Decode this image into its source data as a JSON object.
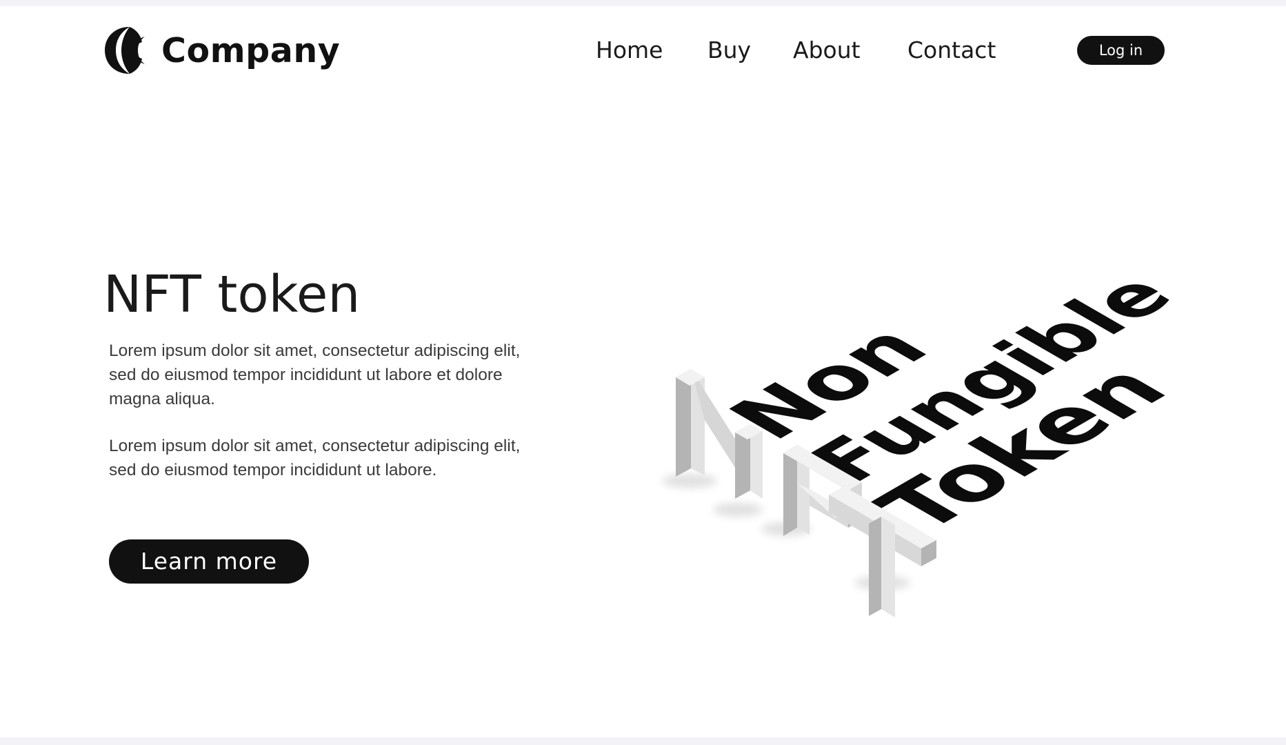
{
  "brand": {
    "name": "Company",
    "logo_icon": "crescent-logo-icon"
  },
  "nav": {
    "items": [
      {
        "label": "Home"
      },
      {
        "label": "Buy"
      },
      {
        "label": "About"
      },
      {
        "label": "Contact"
      }
    ],
    "login_label": "Log in"
  },
  "hero": {
    "title": "NFT token",
    "paragraphs": [
      "Lorem ipsum dolor sit amet, consectetur adipiscing elit, sed do eiusmod tempor incididunt ut labore et dolore magna aliqua.",
      "Lorem ipsum dolor sit amet, consectetur adipiscing elit, sed do eiusmod tempor incididunt ut labore."
    ],
    "cta_label": "Learn more"
  },
  "illustration": {
    "words": [
      "Non",
      "Fungible",
      "Token"
    ],
    "letters": [
      "N",
      "F",
      "T"
    ],
    "colors": {
      "text": "#0c0c0c",
      "block_front": "#e2e2e2",
      "block_side": "#b4b4b4",
      "block_top": "#f2f2f2"
    }
  },
  "theme": {
    "background": "#ffffff",
    "frame": "#f3f2f6",
    "button_bg": "#111111",
    "button_text": "#ffffff"
  }
}
